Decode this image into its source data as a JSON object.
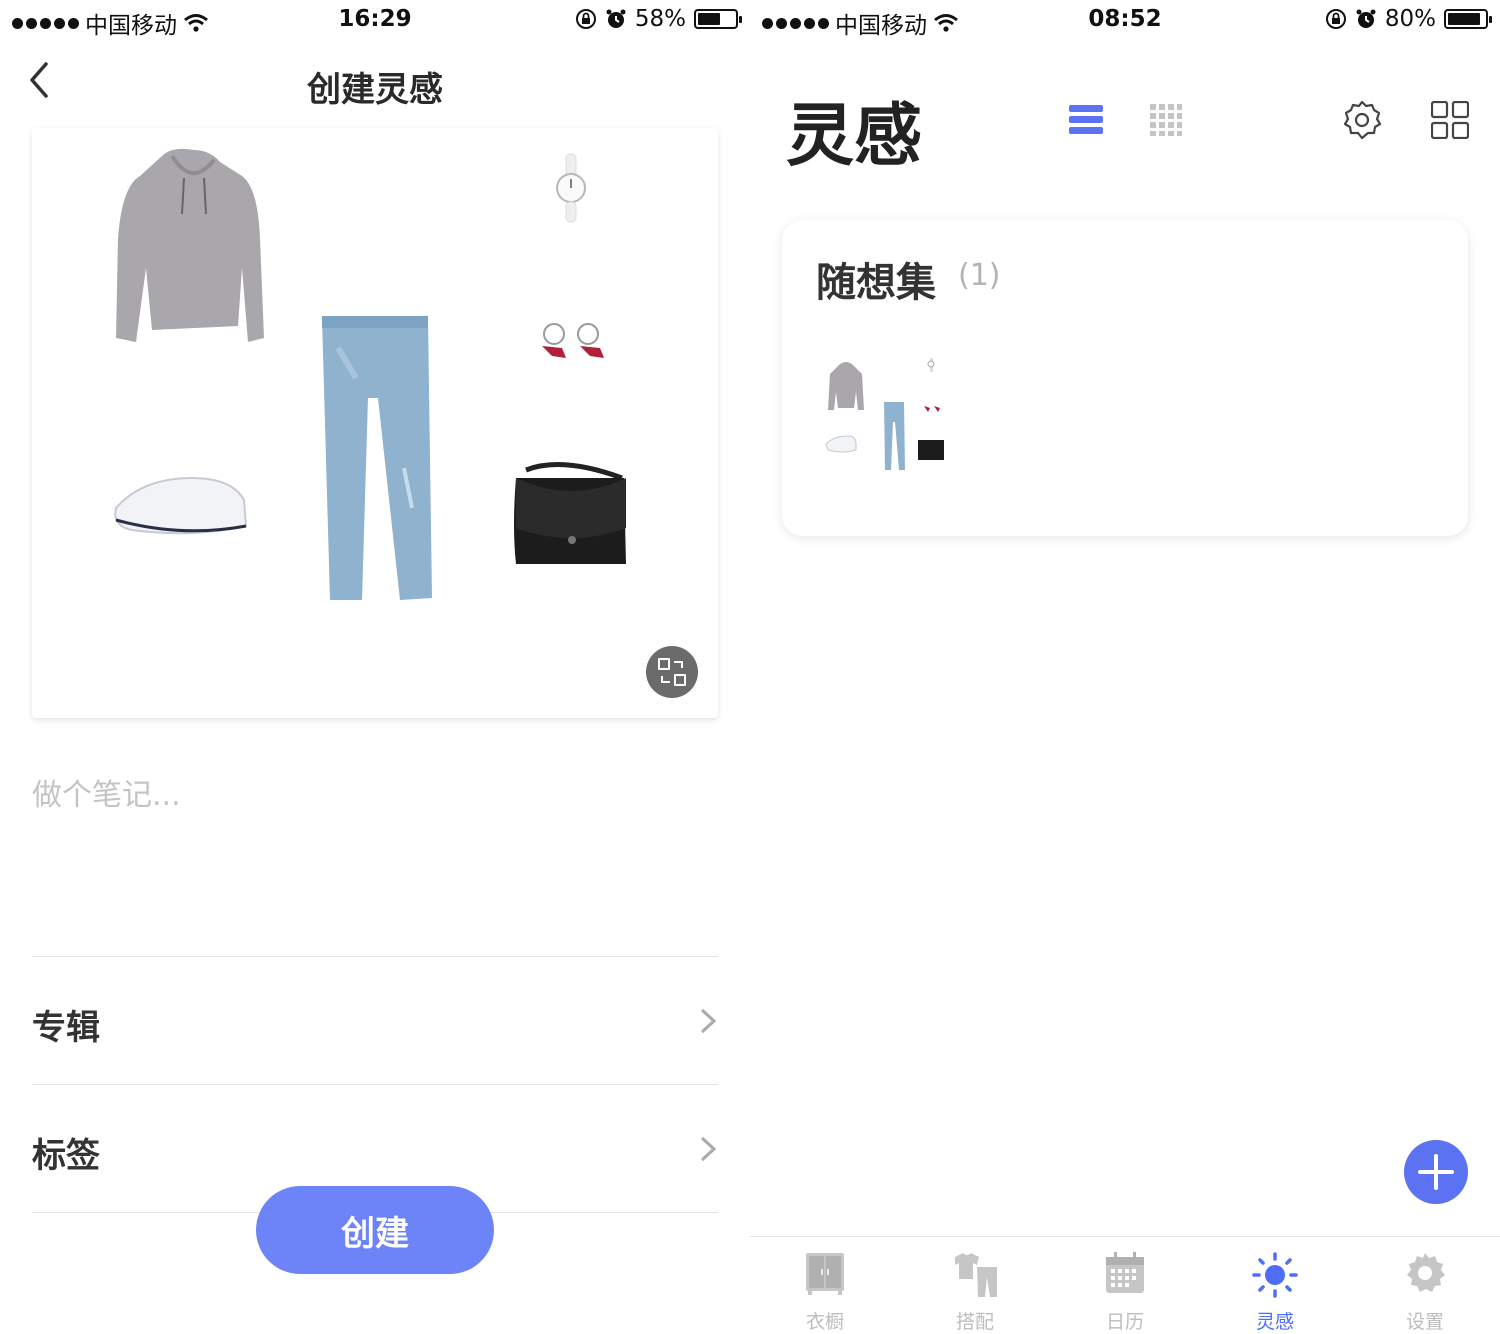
{
  "left": {
    "status": {
      "carrier": "中国移动",
      "time": "16:29",
      "battery": "58%",
      "battery_level": 0.58
    },
    "nav": {
      "title": "创建灵感"
    },
    "note": {
      "placeholder": "做个笔记..."
    },
    "rows": [
      {
        "label": "专辑"
      },
      {
        "label": "标签"
      }
    ],
    "create_button": "创建"
  },
  "right": {
    "status": {
      "carrier": "中国移动",
      "time": "08:52",
      "battery": "80%",
      "battery_level": 0.8
    },
    "title": "灵感",
    "album": {
      "name": "随想集",
      "count": "(1)"
    },
    "tabs": [
      {
        "label": "衣橱",
        "icon": "wardrobe-icon",
        "active": false
      },
      {
        "label": "搭配",
        "icon": "outfit-icon",
        "active": false
      },
      {
        "label": "日历",
        "icon": "calendar-icon",
        "active": false
      },
      {
        "label": "灵感",
        "icon": "inspiration-icon",
        "active": true
      },
      {
        "label": "设置",
        "icon": "gear-icon",
        "active": false
      }
    ]
  },
  "colors": {
    "accent": "#5b72f2",
    "create_button": "#6c84f8",
    "placeholder": "#c4c4c4",
    "tab_inactive": "#bdbdbd"
  }
}
